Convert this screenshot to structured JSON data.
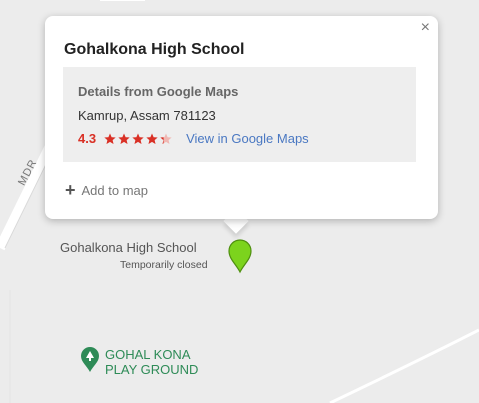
{
  "popup": {
    "title": "Gohalkona High School",
    "close_label": "×",
    "details": {
      "heading": "Details from Google Maps",
      "address": "Kamrup, Assam 781123",
      "rating": "4.3",
      "stars_filled": 4.3,
      "view_link": "View in Google Maps"
    },
    "add_to_map": "Add to map"
  },
  "map": {
    "road_label": "MDR",
    "place_label": "Gohalkona High School",
    "place_status": "Temporarily closed",
    "poi_label": "GOHAL KONA\nPLAY GROUND"
  },
  "colors": {
    "rating": "#d93025",
    "link": "#4a78c2",
    "pin": "#7cd31d",
    "poi": "#2e8b57"
  }
}
